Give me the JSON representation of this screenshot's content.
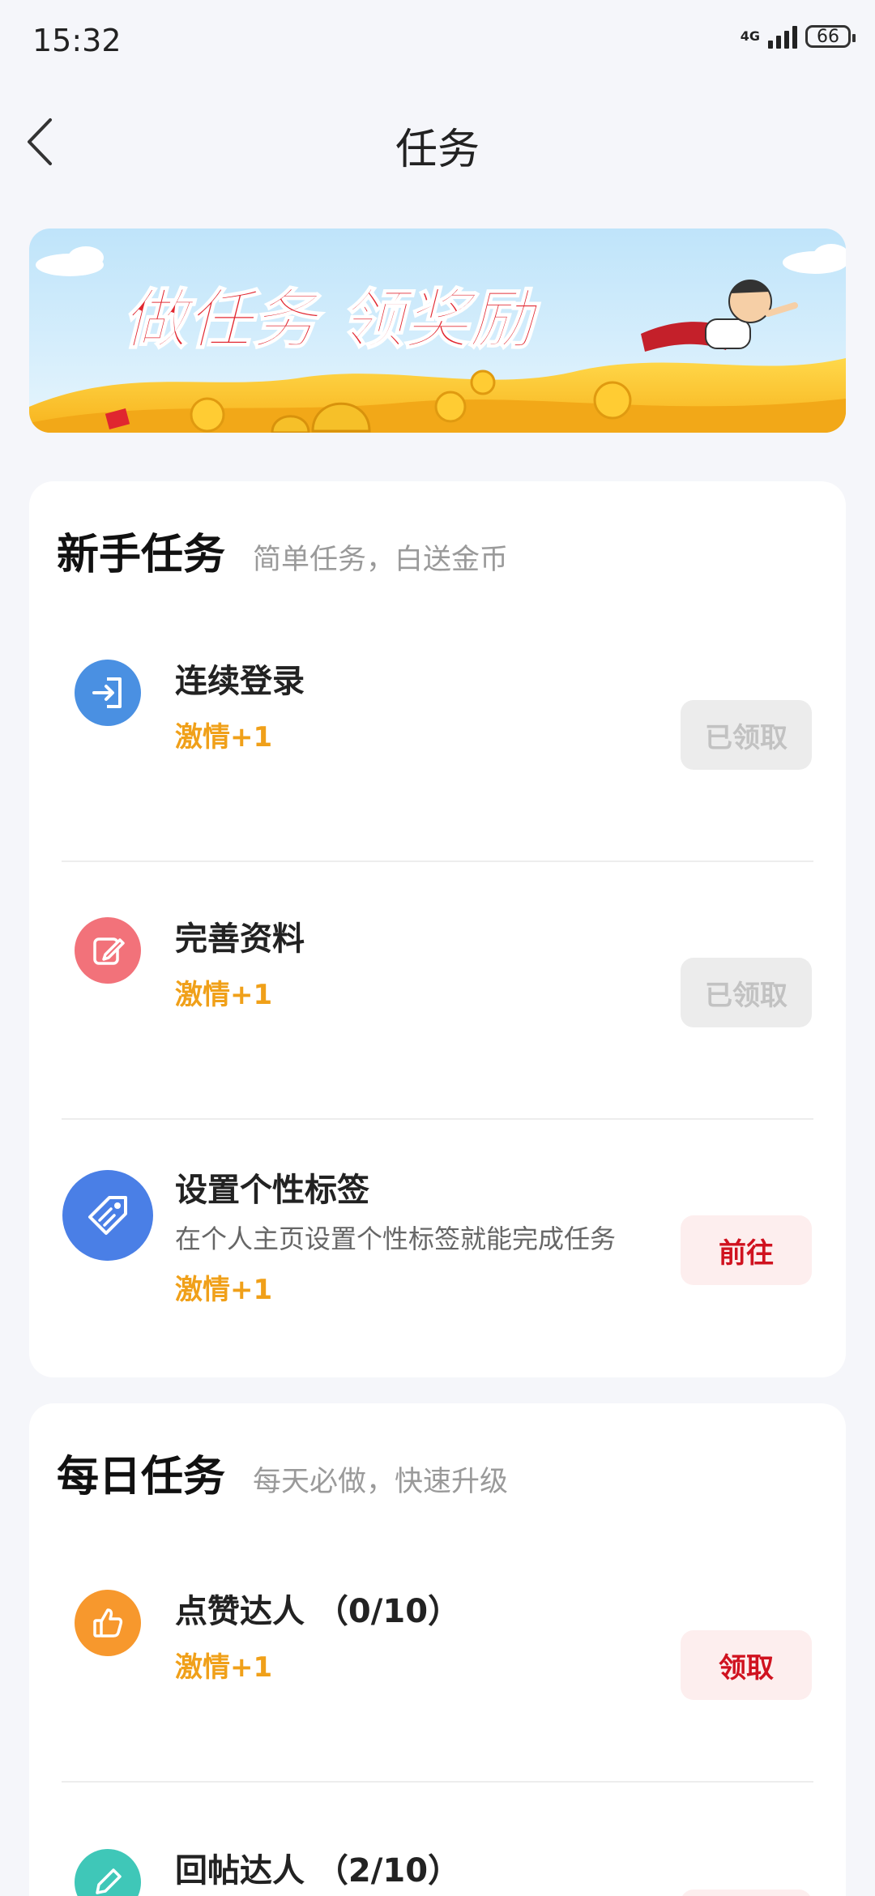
{
  "status_bar": {
    "time": "15:32",
    "network": "4G",
    "battery": "66"
  },
  "header": {
    "title": "任务"
  },
  "banner": {
    "text": "做任务 领奖励"
  },
  "newbie": {
    "title": "新手任务",
    "subtitle": "简单任务，白送金币",
    "tasks": [
      {
        "title": "连续登录",
        "reward": "激情+1",
        "button": "已领取",
        "icon": "login-icon",
        "color": "#4a90e2"
      },
      {
        "title": "完善资料",
        "reward": "激情+1",
        "button": "已领取",
        "icon": "edit-icon",
        "color": "#f2727a"
      },
      {
        "title": "设置个性标签",
        "desc": "在个人主页设置个性标签就能完成任务",
        "reward": "激情+1",
        "button": "前往",
        "icon": "tag-icon",
        "color": "#4a7fe6"
      }
    ]
  },
  "daily": {
    "title": "每日任务",
    "subtitle": "每天必做，快速升级",
    "tasks": [
      {
        "title": "点赞达人 （0/10）",
        "reward": "激情+1",
        "button": "领取",
        "icon": "thumbs-up-icon",
        "color": "#f7982d"
      },
      {
        "title": "回帖达人 （2/10）",
        "icon": "edit-icon",
        "color": "#3fc7b8"
      }
    ]
  },
  "colors": {
    "reward": "#f0a019",
    "accent_red": "#d0121f",
    "page_bg": "#f5f6fa"
  }
}
